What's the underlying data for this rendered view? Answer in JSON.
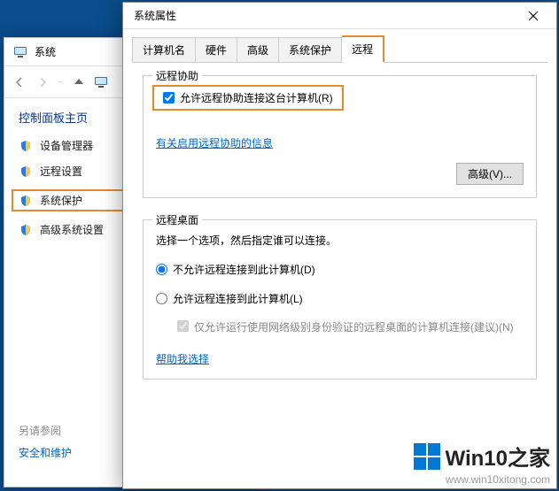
{
  "sysWindow": {
    "title": "系统",
    "controlPanelHeading": "控制面板主页",
    "items": [
      "设备管理器",
      "远程设置",
      "系统保护",
      "高级系统设置"
    ],
    "footer": {
      "heading": "另请参阅",
      "link": "安全和维护"
    }
  },
  "dialog": {
    "title": "系统属性",
    "tabs": [
      "计算机名",
      "硬件",
      "高级",
      "系统保护",
      "远程"
    ],
    "remoteAssist": {
      "legend": "远程协助",
      "checkbox": "允许远程协助连接这台计算机(R)",
      "link": "有关启用远程协助的信息",
      "advancedBtn": "高级(V)..."
    },
    "remoteDesktop": {
      "legend": "远程桌面",
      "helpText": "选择一个选项，然后指定谁可以连接。",
      "radio1": "不允许远程连接到此计算机(D)",
      "radio2": "允许远程连接到此计算机(L)",
      "subCheck": "仅允许运行使用网络级别身份验证的远程桌面的计算机连接(建议)(N)",
      "helpLink": "帮助我选择"
    }
  },
  "watermark": {
    "brand": "Win10之家",
    "url": "www.win10xitong.com"
  }
}
